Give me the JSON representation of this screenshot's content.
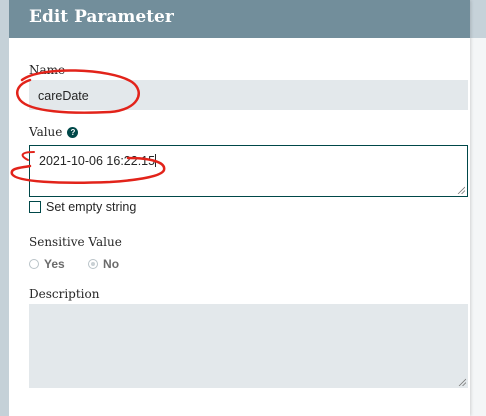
{
  "dialog": {
    "title": "Edit Parameter",
    "name_label": "Name",
    "name_value": "careDate",
    "value_label": "Value",
    "value_value": "2021-10-06 16:22:15",
    "set_empty_label": "Set empty string",
    "sensitive_label": "Sensitive Value",
    "yes_label": "Yes",
    "no_label": "No",
    "description_label": "Description",
    "sensitive_selected": "No"
  },
  "colors": {
    "header_bg": "#728e9b",
    "accent": "#004849",
    "field_bg": "#e3e8eb",
    "annotation": "#e2231a"
  },
  "icons": {
    "help": "help-circle-icon",
    "resize": "resize-grip-icon"
  }
}
